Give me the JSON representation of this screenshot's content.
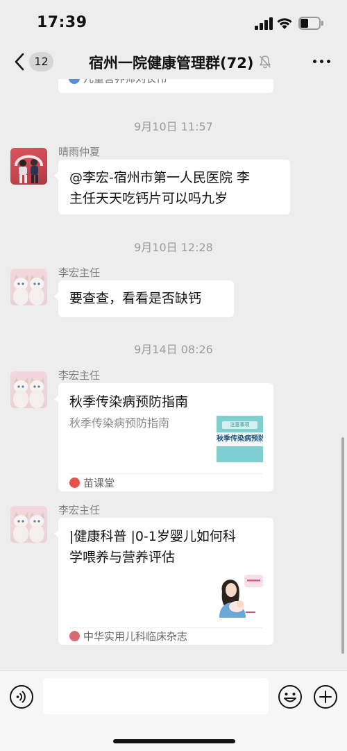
{
  "status_bar": {
    "time": "17:39"
  },
  "nav": {
    "unread_badge": "12",
    "title": "宿州一院健康管理群(72)",
    "icons": {
      "back": "chevron-left",
      "mute": "bell-off",
      "more": "ellipsis"
    }
  },
  "chat": {
    "previous_card_source": "儿童营养师刘长伟",
    "messages": [
      {
        "type": "timestamp",
        "text": "9月10日 11:57"
      },
      {
        "type": "text",
        "sender": "晴雨仲夏",
        "lines": [
          "@李宏-宿州市第一人民医院 李",
          "主任天天吃钙片可以吗九岁"
        ]
      },
      {
        "type": "timestamp",
        "text": "9月10日 12:28"
      },
      {
        "type": "text",
        "sender": "李宏主任",
        "lines": [
          "要查查，看看是否缺钙"
        ]
      },
      {
        "type": "timestamp",
        "text": "9月14日 08:26"
      },
      {
        "type": "link_card",
        "sender": "李宏主任",
        "title": "秋季传染病预防指南",
        "description": "秋季传染病预防指南",
        "thumbnail_tag": "注意事项",
        "thumbnail_text": "秋季传染病预防",
        "source": "苗课堂",
        "source_color": "#e8504a"
      },
      {
        "type": "link_card",
        "sender": "李宏主任",
        "title_lines": [
          "|健康科普 |0-1岁婴儿如何科",
          "学喂养与营养评估"
        ],
        "source": "中华实用儿科临床杂志",
        "source_color": "#d96a74"
      }
    ]
  },
  "input_bar": {
    "icons": {
      "voice": "voice-wave",
      "emoji": "smiley",
      "more": "plus"
    }
  },
  "colors": {
    "chat_background": "#ededed",
    "bubble": "#ffffff",
    "timestamp": "#9b9b9b"
  }
}
